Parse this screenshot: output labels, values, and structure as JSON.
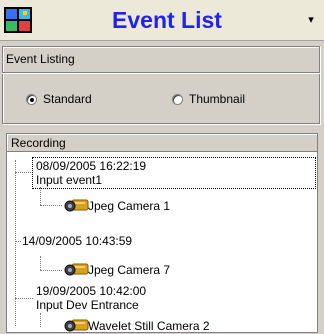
{
  "title": {
    "text": "Event List",
    "menu_arrow": "▾"
  },
  "event_listing": {
    "label": "Event Listing",
    "options": [
      {
        "label": "Standard",
        "selected": true
      },
      {
        "label": "Thumbnail",
        "selected": false
      }
    ]
  },
  "recording_list": {
    "header": "Recording",
    "events": [
      {
        "datetime": "08/09/2005 16:22:19",
        "event": "Input event1",
        "camera": "Jpeg Camera 1",
        "icon": "security-camera-icon"
      },
      {
        "datetime": "14/09/2005 10:43:59",
        "event": "",
        "camera": "Jpeg Camera 7",
        "icon": "security-camera-icon"
      },
      {
        "datetime": "19/09/2005 10:42:00",
        "event": "Input Dev Entrance",
        "camera": "Wavelet Still Camera 2",
        "icon": "security-camera-icon"
      }
    ]
  },
  "colors": {
    "title_text": "#2222ee",
    "background": "#d4d0c8",
    "list_background": "#ffffff"
  }
}
